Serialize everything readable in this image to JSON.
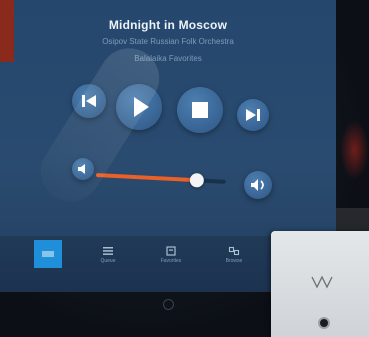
{
  "now_playing": {
    "title": "Midnight in Moscow",
    "artist": "Osipov State Russian Folk Orchestra",
    "album": "Balalaika Favorites"
  },
  "controls": {
    "previous_icon": "previous-track-icon",
    "play_icon": "play-icon",
    "stop_icon": "stop-icon",
    "next_icon": "next-track-icon"
  },
  "volume": {
    "level": 0.78,
    "low_icon": "volume-low-icon",
    "high_icon": "volume-high-icon",
    "fill_color": "#e8612a"
  },
  "tabs": [
    {
      "label": "",
      "icon": "now-playing-icon",
      "active": true
    },
    {
      "label": "Queue",
      "icon": "queue-list-icon"
    },
    {
      "label": "Favorites",
      "icon": "favorites-icon"
    },
    {
      "label": "Browse",
      "icon": "browse-icon"
    }
  ],
  "colors": {
    "screen_background": "#25476d",
    "button_blue": "#3a6797",
    "active_tab": "#1e8fd8"
  }
}
